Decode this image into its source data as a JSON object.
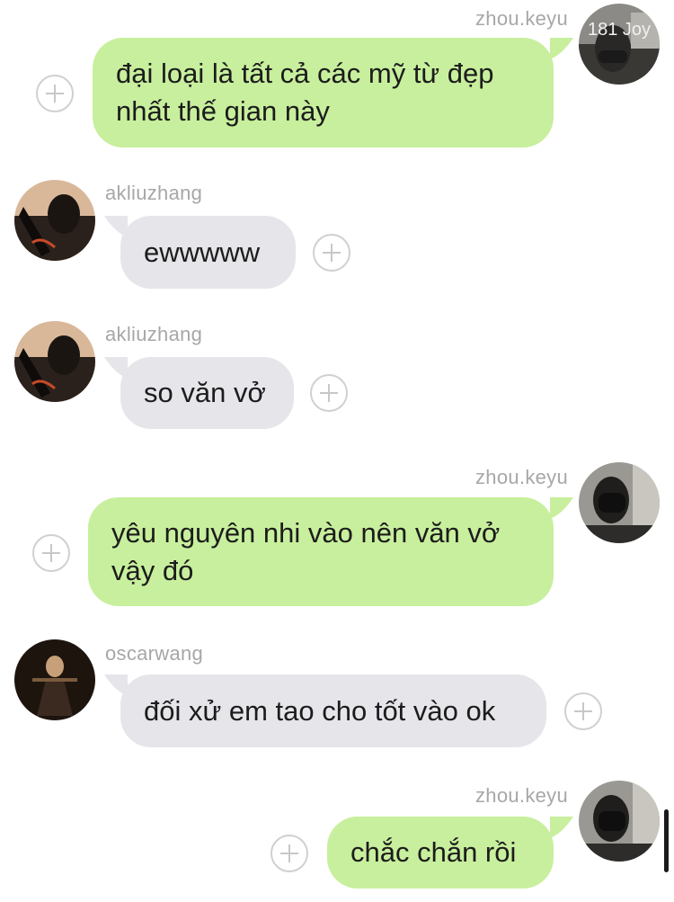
{
  "messages": [
    {
      "sender": "zhou.keyu",
      "side": "right",
      "text": "đại loại là tất cả các mỹ từ đẹp nhất thế gian này",
      "avatar_overlay": "181 Joy"
    },
    {
      "sender": "akliuzhang",
      "side": "left",
      "text": "ewwwww"
    },
    {
      "sender": "akliuzhang",
      "side": "left",
      "text": "so văn vở"
    },
    {
      "sender": "zhou.keyu",
      "side": "right",
      "text": "yêu nguyên nhi vào nên văn vở vậy đó"
    },
    {
      "sender": "oscarwang",
      "side": "left",
      "text": "đối xử em tao cho tốt vào ok"
    },
    {
      "sender": "zhou.keyu",
      "side": "right",
      "text": "chắc chắn rồi"
    }
  ],
  "colors": {
    "outgoing_bubble": "#c8ef9d",
    "incoming_bubble": "#e5e5ea",
    "username": "#a7a7a7"
  },
  "icons": {
    "react_button": "add-reaction-icon"
  }
}
